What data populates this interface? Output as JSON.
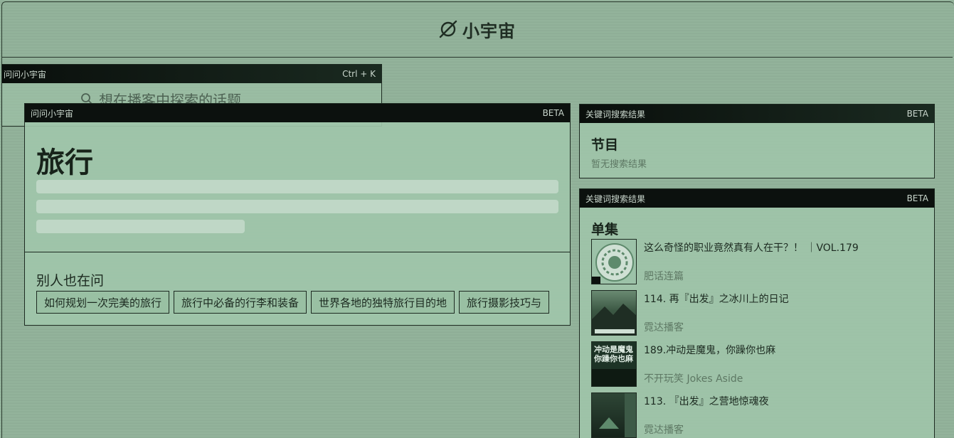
{
  "app": {
    "name": "小宇宙"
  },
  "back_panel": {
    "header_left": "问问小宇宙",
    "header_right": "Ctrl + K",
    "search_placeholder": "想在播客中探索的话题"
  },
  "main_panel": {
    "header_left": "问问小宇宙",
    "header_right": "BETA",
    "query": "旅行",
    "others_title": "别人也在问",
    "chips": [
      "如何规划一次完美的旅行",
      "旅行中必备的行李和装备",
      "世界各地的独特旅行目的地",
      "旅行摄影技巧与"
    ]
  },
  "shows_panel": {
    "header_left": "关键词搜索结果",
    "header_right": "BETA",
    "section_title": "节目",
    "empty_text": "暂无搜索结果"
  },
  "episodes_panel": {
    "header_left": "关键词搜索结果",
    "header_right": "BETA",
    "section_title": "单集",
    "episodes": [
      {
        "title": "这么奇怪的职业竟然真有人在干？！ ｜VOL.179",
        "show": "肥话连篇"
      },
      {
        "title": "114. 再『出发』之冰川上的日记",
        "show": "霓达播客"
      },
      {
        "title": "189.冲动是魔鬼，你躁你也麻",
        "show": "不开玩笑 Jokes Aside",
        "thumb_text": [
          "冲动是魔鬼",
          "你躁你也麻"
        ]
      },
      {
        "title": "113. 『出发』之营地惊魂夜",
        "show": "霓达播客"
      }
    ]
  },
  "colors": {
    "background": "#93b39b",
    "header_bar": "#0c110e",
    "text": "#1c2a20",
    "muted": "#5e7864"
  }
}
